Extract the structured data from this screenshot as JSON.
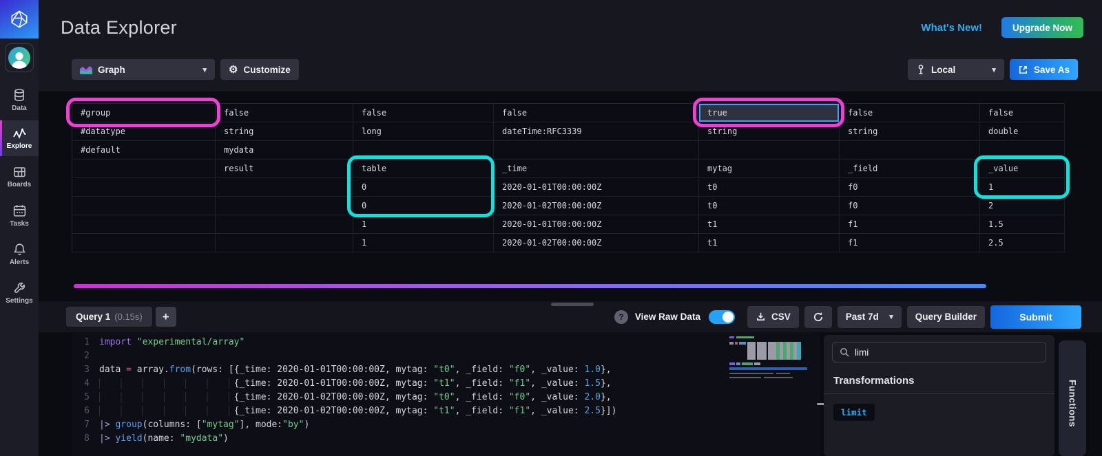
{
  "app": {
    "title": "Data Explorer",
    "whats_new": "What's New!",
    "upgrade": "Upgrade Now"
  },
  "icons": {
    "gear": "⚙",
    "caret": "▾",
    "plus": "+",
    "help": "?"
  },
  "colors": {
    "accent_blue": "#22a3f5",
    "annotation_pink": "#f03ed6",
    "annotation_cyan": "#0de2de",
    "gradient_bar": [
      "#cf2fd4",
      "#9b5cf0",
      "#3f8cff"
    ],
    "upgrade_gradient": [
      "#1f7ae8",
      "#33bb54"
    ]
  },
  "sidebar": {
    "items": [
      {
        "label": "Data"
      },
      {
        "label": "Explore"
      },
      {
        "label": "Boards"
      },
      {
        "label": "Tasks"
      },
      {
        "label": "Alerts"
      },
      {
        "label": "Settings"
      }
    ]
  },
  "toolbar": {
    "view_type": "Graph",
    "customize": "Customize",
    "scope": "Local",
    "save_as": "Save As"
  },
  "table": {
    "selected": {
      "row": 0,
      "col": 4
    },
    "rows": [
      [
        "#group",
        "false",
        "false",
        "false",
        "true",
        "false",
        "false"
      ],
      [
        "#datatype",
        "string",
        "long",
        "dateTime:RFC3339",
        "string",
        "string",
        "double"
      ],
      [
        "#default",
        "mydata",
        "",
        "",
        "",
        "",
        ""
      ],
      [
        "",
        "result",
        "table",
        "_time",
        "mytag",
        "_field",
        "_value"
      ],
      [
        "",
        "",
        "0",
        "2020-01-01T00:00:00Z",
        "t0",
        "f0",
        "1"
      ],
      [
        "",
        "",
        "0",
        "2020-01-02T00:00:00Z",
        "t0",
        "f0",
        "2"
      ],
      [
        "",
        "",
        "1",
        "2020-01-01T00:00:00Z",
        "t1",
        "f1",
        "1.5"
      ],
      [
        "",
        "",
        "1",
        "2020-01-02T00:00:00Z",
        "t1",
        "f1",
        "2.5"
      ]
    ]
  },
  "querybar": {
    "tab_label": "Query 1",
    "tab_time": "(0.15s)",
    "view_raw": "View Raw Data",
    "raw_toggle_on": true,
    "csv": "CSV",
    "range": "Past 7d",
    "builder": "Query Builder",
    "submit": "Submit"
  },
  "editor": {
    "lines": [
      {
        "n": "1",
        "tokens": [
          [
            "kw",
            "import"
          ],
          [
            "plain",
            " "
          ],
          [
            "str",
            "\"experimental/array\""
          ]
        ]
      },
      {
        "n": "2",
        "tokens": []
      },
      {
        "n": "3",
        "tokens": [
          [
            "plain",
            "data "
          ],
          [
            "op",
            "="
          ],
          [
            "plain",
            " array."
          ],
          [
            "fn",
            "from"
          ],
          [
            "plain",
            "(rows: [{_time: 2020-01-01T00:00:00Z, mytag: "
          ],
          [
            "str",
            "\"t0\""
          ],
          [
            "plain",
            ", _field: "
          ],
          [
            "str",
            "\"f0\""
          ],
          [
            "plain",
            ", _value: "
          ],
          [
            "num",
            "1.0"
          ],
          [
            "plain",
            "},"
          ]
        ]
      },
      {
        "n": "4",
        "tokens": [
          [
            "indent",
            "                         "
          ],
          [
            "plain",
            "{_time: 2020-01-01T00:00:00Z, mytag: "
          ],
          [
            "str",
            "\"t1\""
          ],
          [
            "plain",
            ", _field: "
          ],
          [
            "str",
            "\"f1\""
          ],
          [
            "plain",
            ", _value: "
          ],
          [
            "num",
            "1.5"
          ],
          [
            "plain",
            "},"
          ]
        ]
      },
      {
        "n": "5",
        "tokens": [
          [
            "indent",
            "                         "
          ],
          [
            "plain",
            "{_time: 2020-01-02T00:00:00Z, mytag: "
          ],
          [
            "str",
            "\"t0\""
          ],
          [
            "plain",
            ", _field: "
          ],
          [
            "str",
            "\"f0\""
          ],
          [
            "plain",
            ", _value: "
          ],
          [
            "num",
            "2.0"
          ],
          [
            "plain",
            "},"
          ]
        ]
      },
      {
        "n": "6",
        "tokens": [
          [
            "indent",
            "                         "
          ],
          [
            "plain",
            "{_time: 2020-01-02T00:00:00Z, mytag: "
          ],
          [
            "str",
            "\"t1\""
          ],
          [
            "plain",
            ", _field: "
          ],
          [
            "str",
            "\"f1\""
          ],
          [
            "plain",
            ", _value: "
          ],
          [
            "num",
            "2.5"
          ],
          [
            "plain",
            "}])"
          ]
        ]
      },
      {
        "n": "7",
        "tokens": [
          [
            "pipe",
            "|>"
          ],
          [
            "plain",
            " "
          ],
          [
            "fn",
            "group"
          ],
          [
            "plain",
            "(columns: ["
          ],
          [
            "str",
            "\"mytag\""
          ],
          [
            "plain",
            "], mode:"
          ],
          [
            "str",
            "\"by\""
          ],
          [
            "plain",
            ")"
          ]
        ]
      },
      {
        "n": "8",
        "tokens": [
          [
            "pipe",
            "|>"
          ],
          [
            "plain",
            " "
          ],
          [
            "fn",
            "yield"
          ],
          [
            "plain",
            "(name: "
          ],
          [
            "str",
            "\"mydata\""
          ],
          [
            "plain",
            ")"
          ]
        ]
      }
    ]
  },
  "functions": {
    "search_value": "limi",
    "section": "Transformations",
    "items": [
      "limit"
    ],
    "tab": "Functions"
  }
}
